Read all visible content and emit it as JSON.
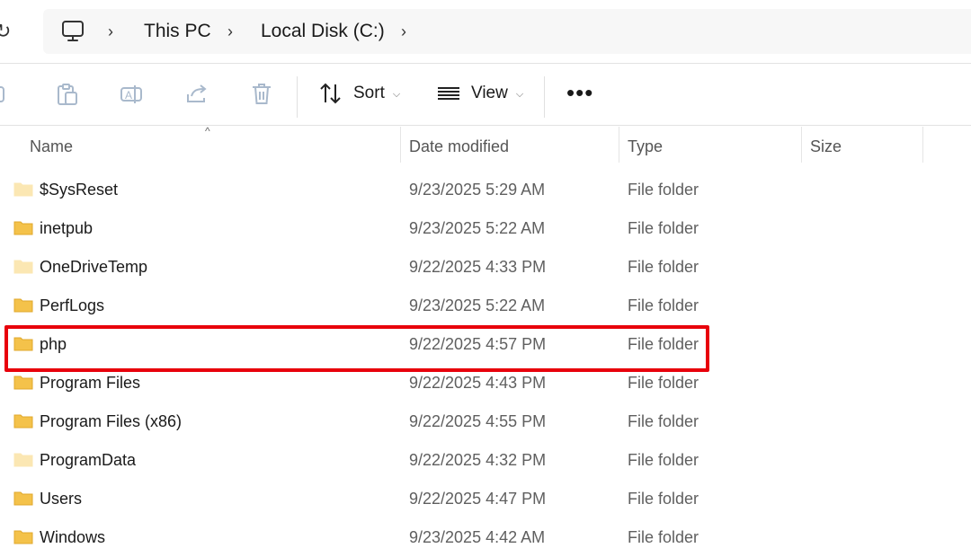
{
  "address_bar": {
    "breadcrumbs": [
      "This PC",
      "Local Disk (C:)"
    ],
    "icons": {
      "refresh": "refresh-icon",
      "location": "monitor-icon",
      "separator": "chevron-right-icon"
    }
  },
  "command_bar": {
    "tools": [
      "copy-icon",
      "paste-icon",
      "rename-icon",
      "share-icon",
      "delete-icon"
    ],
    "sort_label": "Sort",
    "view_label": "View",
    "more_label": "•••"
  },
  "columns": {
    "name": "Name",
    "date_modified": "Date modified",
    "type": "Type",
    "size": "Size",
    "sort_indicator": "^"
  },
  "files": [
    {
      "name": "$SysReset",
      "date": "9/23/2025 5:29 AM",
      "type": "File folder",
      "hidden": true
    },
    {
      "name": "inetpub",
      "date": "9/23/2025 5:22 AM",
      "type": "File folder",
      "hidden": false
    },
    {
      "name": "OneDriveTemp",
      "date": "9/22/2025 4:33 PM",
      "type": "File folder",
      "hidden": true
    },
    {
      "name": "PerfLogs",
      "date": "9/23/2025 5:22 AM",
      "type": "File folder",
      "hidden": false
    },
    {
      "name": "php",
      "date": "9/22/2025 4:57 PM",
      "type": "File folder",
      "hidden": false,
      "highlighted": true
    },
    {
      "name": "Program Files",
      "date": "9/22/2025 4:43 PM",
      "type": "File folder",
      "hidden": false
    },
    {
      "name": "Program Files (x86)",
      "date": "9/22/2025 4:55 PM",
      "type": "File folder",
      "hidden": false
    },
    {
      "name": "ProgramData",
      "date": "9/22/2025 4:32 PM",
      "type": "File folder",
      "hidden": true
    },
    {
      "name": "Users",
      "date": "9/22/2025 4:47 PM",
      "type": "File folder",
      "hidden": false
    },
    {
      "name": "Windows",
      "date": "9/23/2025 4:42 AM",
      "type": "File folder",
      "hidden": false
    }
  ],
  "colors": {
    "folder": "#f4c24a",
    "folder_dark": "#e0a82c",
    "folder_hidden": "#fbe7b3",
    "highlight_border": "#e8000b"
  }
}
